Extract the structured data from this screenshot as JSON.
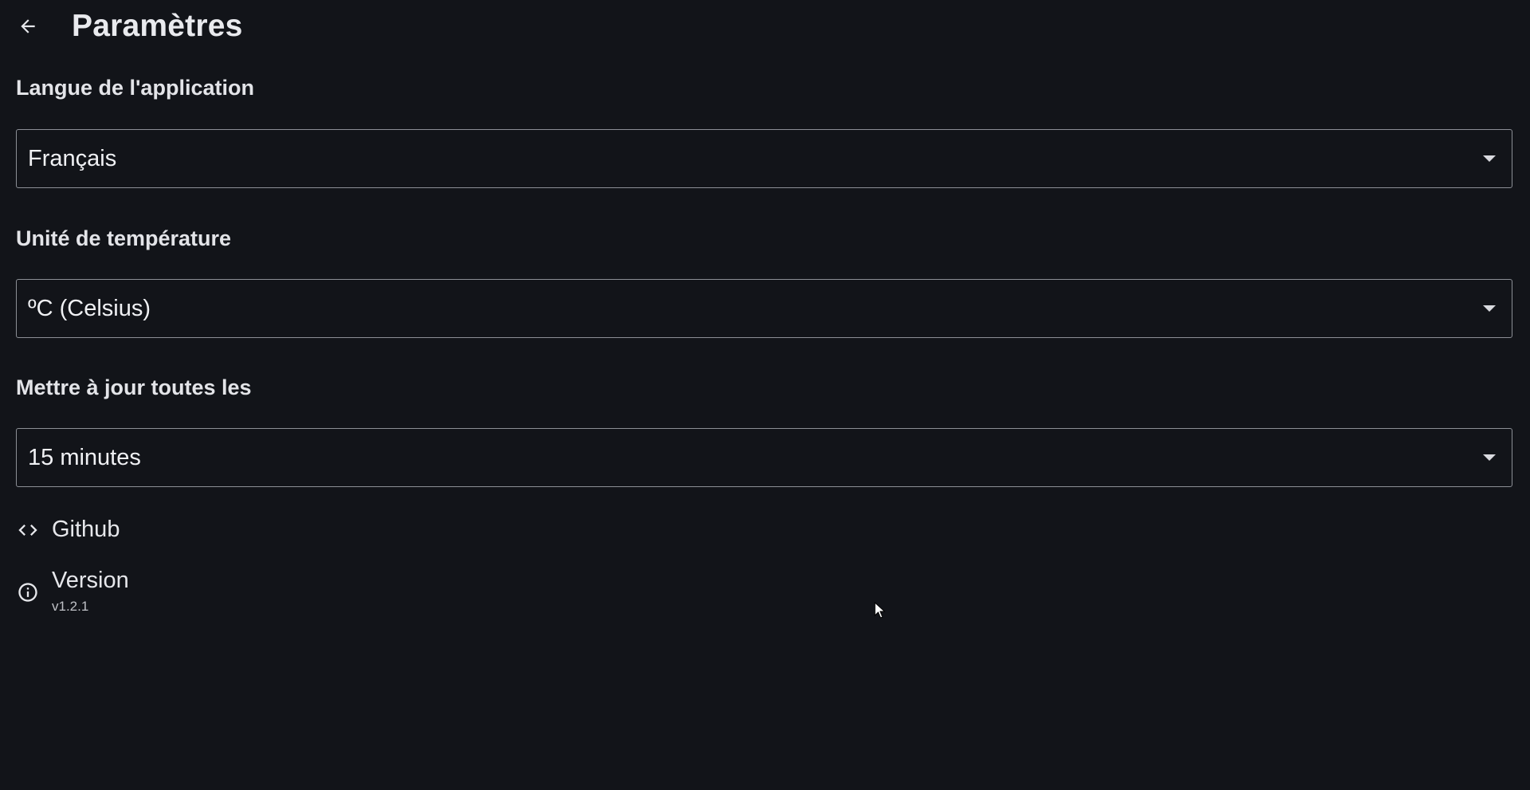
{
  "header": {
    "back_label": "back",
    "title": "Paramètres"
  },
  "settings": {
    "language": {
      "label": "Langue de l'application",
      "value": "Français"
    },
    "temperature": {
      "label": "Unité de température",
      "value": "ºC (Celsius)"
    },
    "update_interval": {
      "label": "Mettre à jour toutes les",
      "value": "15 minutes"
    }
  },
  "links": {
    "github": {
      "label": "Github",
      "icon": "code-icon"
    },
    "version": {
      "label": "Version",
      "value": "v1.2.1",
      "icon": "info-icon"
    }
  },
  "colors": {
    "background": "#121419",
    "text": "#e6e7eb",
    "border": "#8c8f96"
  }
}
